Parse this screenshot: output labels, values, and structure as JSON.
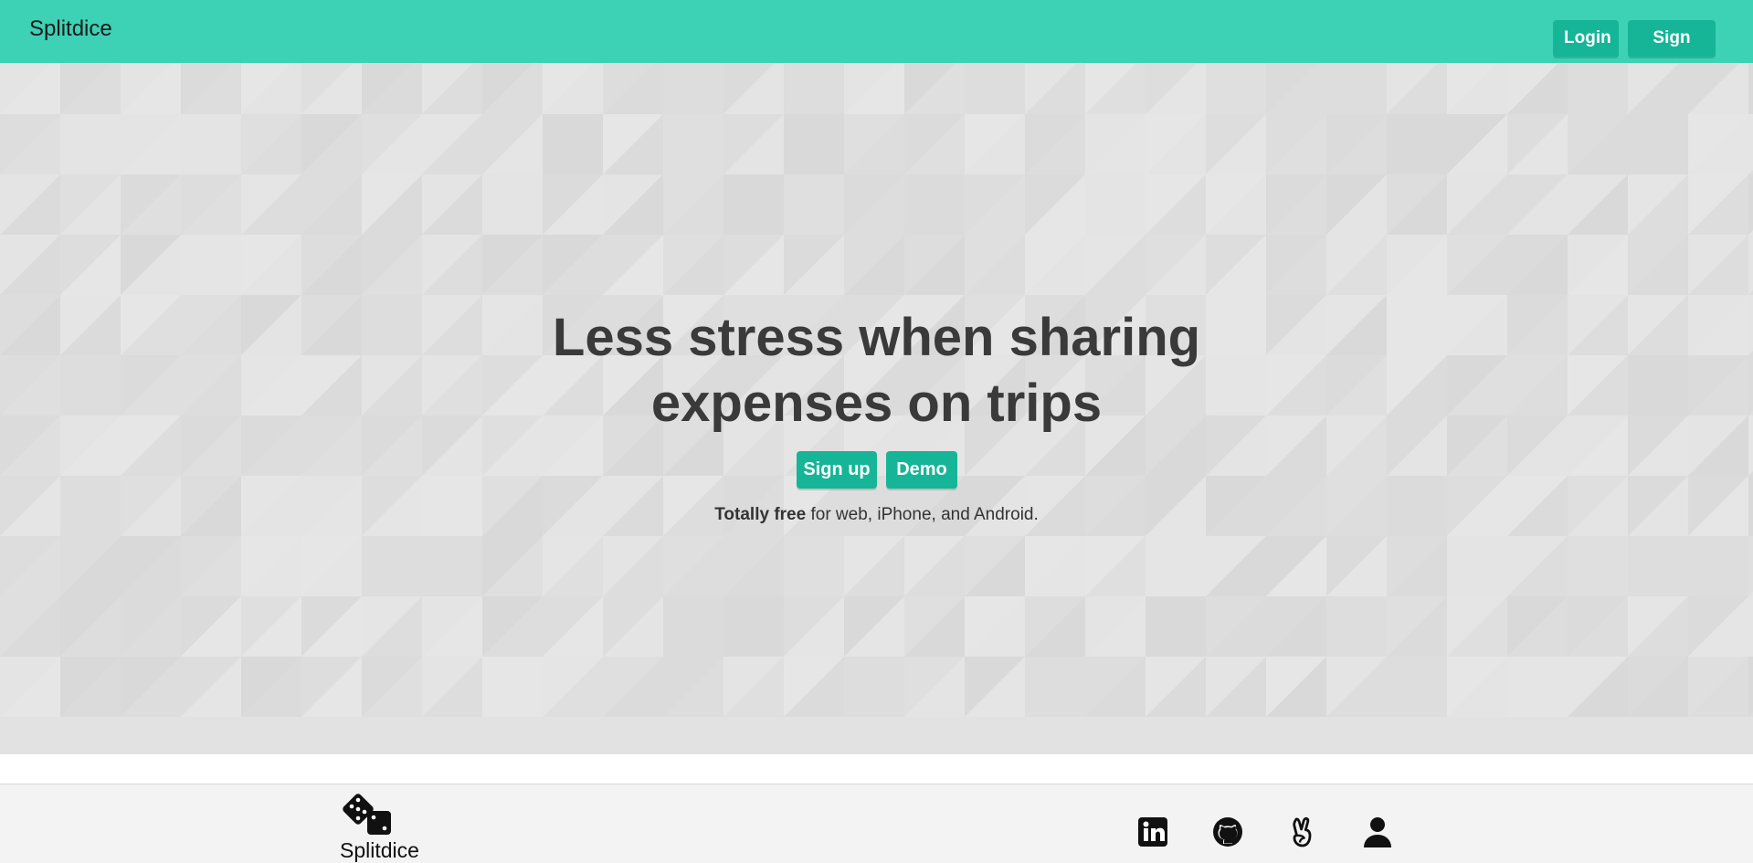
{
  "header": {
    "brand": "Splitdice",
    "login_label": "Login",
    "signup_label": "Sign up!"
  },
  "hero": {
    "headline_line1": "Less stress when sharing",
    "headline_line2_regular": "expenses ",
    "headline_line2_bold": "on trips",
    "signup_label": "Sign up",
    "demo_label": "Demo",
    "tagline_bold": "Totally free",
    "tagline_rest": " for web, iPhone, and Android."
  },
  "footer": {
    "brand": "Splitdice",
    "logo_icon": "dice-icon",
    "social_icons": [
      "linkedin-icon",
      "github-icon",
      "angellist-icon",
      "person-icon"
    ]
  },
  "colors": {
    "accent": "#3dd1b5",
    "button": "#16b597",
    "hero_bg": "#e2e2e2",
    "footer_bg": "#f3f3f3"
  }
}
